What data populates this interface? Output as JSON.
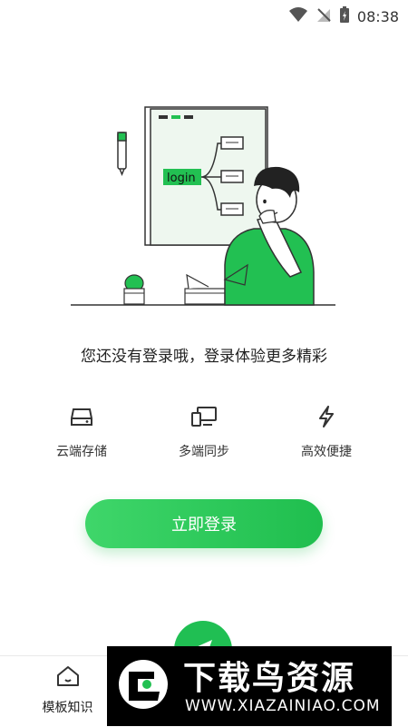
{
  "status_bar": {
    "time": "08:38",
    "icons": [
      "wifi-icon",
      "signal-off-icon",
      "battery-charging-icon"
    ]
  },
  "illustration": {
    "board_label": "login"
  },
  "login_prompt": "您还没有登录哦，登录体验更多精彩",
  "features": [
    {
      "icon": "cloud-storage-icon",
      "label": "云端存储"
    },
    {
      "icon": "multi-device-sync-icon",
      "label": "多端同步"
    },
    {
      "icon": "lightning-icon",
      "label": "高效便捷"
    }
  ],
  "login_button": {
    "label": "立即登录"
  },
  "fab": {
    "icon": "paper-plane-icon"
  },
  "bottom_nav": {
    "items": [
      {
        "icon": "home-icon",
        "label": "模板知识"
      }
    ]
  },
  "watermark": {
    "title": "下载鸟资源",
    "url": "WWW.XIAZAINIAO.COM"
  },
  "colors": {
    "accent": "#22c052",
    "text": "#222222"
  }
}
